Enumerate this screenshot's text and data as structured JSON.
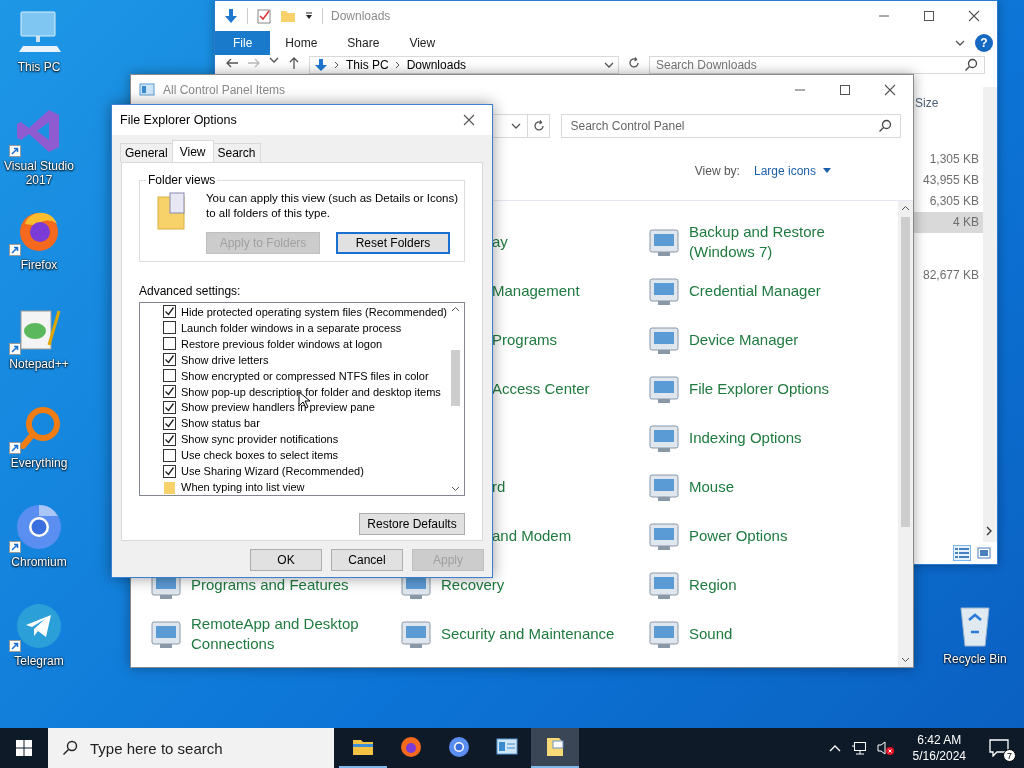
{
  "desktop": {
    "icons": [
      {
        "label": "This PC",
        "kind": "computer",
        "shortcut": false
      },
      {
        "label": "Visual Studio 2017",
        "kind": "visual-studio",
        "shortcut": true
      },
      {
        "label": "Firefox",
        "kind": "firefox",
        "shortcut": true
      },
      {
        "label": "Notepad++",
        "kind": "notepad",
        "shortcut": true
      },
      {
        "label": "Everything",
        "kind": "everything",
        "shortcut": true
      },
      {
        "label": "Chromium",
        "kind": "chromium",
        "shortcut": true
      },
      {
        "label": "Telegram",
        "kind": "telegram",
        "shortcut": true
      }
    ],
    "right_icons": [
      {
        "label": "Recycle Bin",
        "kind": "recycle-bin",
        "shortcut": false
      }
    ]
  },
  "explorer_window": {
    "title": "Downloads",
    "ribbon_tabs": [
      {
        "label": "File",
        "selected": true
      },
      {
        "label": "Home",
        "selected": false
      },
      {
        "label": "Share",
        "selected": false
      },
      {
        "label": "View",
        "selected": false
      }
    ],
    "help": "?",
    "breadcrumb": [
      "This PC",
      "Downloads"
    ],
    "search": {
      "placeholder": "Search Downloads"
    },
    "column_header": "Size",
    "groups": [
      {
        "rows": [
          {
            "size": "1,305 KB",
            "selected": false
          },
          {
            "size": "43,955 KB",
            "selected": false
          },
          {
            "size": "6,305 KB",
            "selected": false
          },
          {
            "size": "4 KB",
            "selected": true
          }
        ]
      },
      {
        "rows": [
          {
            "size": "82,677 KB",
            "selected": false
          }
        ]
      }
    ],
    "view_buttons": [
      {
        "kind": "details",
        "selected": true
      },
      {
        "kind": "large-icons",
        "selected": false
      }
    ]
  },
  "control_panel": {
    "title": "All Control Panel Items",
    "search": {
      "placeholder": "Search Control Panel"
    },
    "view_by": {
      "label": "View by:",
      "value": "Large icons"
    },
    "rows": [
      {
        "column_2": {
          "label": "ay",
          "kind": "partial"
        },
        "column_3": {
          "label": "Backup and Restore (Windows 7)",
          "kind": "applet"
        }
      },
      {
        "column_2": {
          "label": "Management",
          "kind": "partial"
        },
        "column_3": {
          "label": "Credential Manager",
          "kind": "applet"
        }
      },
      {
        "column_2": {
          "label": "Programs",
          "kind": "partial"
        },
        "column_3": {
          "label": "Device Manager",
          "kind": "applet"
        }
      },
      {
        "column_2": {
          "label": "Access Center",
          "kind": "partial"
        },
        "column_3": {
          "label": "File Explorer Options",
          "kind": "applet"
        }
      },
      {
        "column_3": {
          "label": "Indexing Options",
          "kind": "applet"
        }
      },
      {
        "column_2": {
          "label": "rd",
          "kind": "partial"
        },
        "column_3": {
          "label": "Mouse",
          "kind": "applet"
        }
      },
      {
        "column_2": {
          "label": "and Modem",
          "kind": "partial"
        },
        "column_3": {
          "label": "Power Options",
          "kind": "applet"
        }
      },
      {
        "column_1": {
          "label": "Programs and Features",
          "kind": "applet"
        },
        "column_2": {
          "label": "Recovery",
          "kind": "applet"
        },
        "column_3": {
          "label": "Region",
          "kind": "applet"
        }
      },
      {
        "column_1": {
          "label": "RemoteApp and Desktop Connections",
          "kind": "applet"
        },
        "column_2": {
          "label": "Security and Maintenance",
          "kind": "applet"
        },
        "column_3": {
          "label": "Sound",
          "kind": "applet"
        }
      }
    ]
  },
  "dialog": {
    "title": "File Explorer Options",
    "tabs": [
      {
        "label": "General",
        "selected": false
      },
      {
        "label": "View",
        "selected": true
      },
      {
        "label": "Search",
        "selected": false
      }
    ],
    "folder_views": {
      "title": "Folder views",
      "text": "You can apply this view (such as Details or Icons) to all folders of this type.",
      "buttons": [
        {
          "label": "Apply to Folders",
          "disabled": true,
          "default": false
        },
        {
          "label": "Reset Folders",
          "disabled": false,
          "default": true
        }
      ]
    },
    "advanced_label": "Advanced settings:",
    "settings": [
      {
        "kind": "checkbox",
        "label": "Hide protected operating system files (Recommended)",
        "checked": true
      },
      {
        "kind": "checkbox",
        "label": "Launch folder windows in a separate process",
        "checked": false
      },
      {
        "kind": "checkbox",
        "label": "Restore previous folder windows at logon",
        "checked": false
      },
      {
        "kind": "checkbox",
        "label": "Show drive letters",
        "checked": true
      },
      {
        "kind": "checkbox",
        "label": "Show encrypted or compressed NTFS files in color",
        "checked": false
      },
      {
        "kind": "checkbox",
        "label": "Show pop-up description for folder and desktop items",
        "checked": true
      },
      {
        "kind": "checkbox",
        "label": "Show preview handlers in preview pane",
        "checked": true
      },
      {
        "kind": "checkbox",
        "label": "Show status bar",
        "checked": true
      },
      {
        "kind": "checkbox",
        "label": "Show sync provider notifications",
        "checked": true
      },
      {
        "kind": "checkbox",
        "label": "Use check boxes to select items",
        "checked": false
      },
      {
        "kind": "checkbox",
        "label": "Use Sharing Wizard (Recommended)",
        "checked": true
      },
      {
        "kind": "folder",
        "label": "When typing into list view"
      }
    ],
    "restore_button": "Restore Defaults",
    "buttons": [
      {
        "label": "OK",
        "disabled": false
      },
      {
        "label": "Cancel",
        "disabled": false
      },
      {
        "label": "Apply",
        "disabled": true
      }
    ]
  },
  "taskbar": {
    "search": {
      "placeholder": "Type here to search"
    },
    "apps": [
      {
        "kind": "explorer",
        "running": true,
        "active": false
      },
      {
        "kind": "firefox",
        "running": false,
        "active": false
      },
      {
        "kind": "chromium",
        "running": false,
        "active": false
      },
      {
        "kind": "control-panel",
        "running": false,
        "active": false
      },
      {
        "kind": "options",
        "running": true,
        "active": true
      }
    ],
    "time": "6:42 AM",
    "date": "5/16/2024",
    "notification_count": "7"
  }
}
